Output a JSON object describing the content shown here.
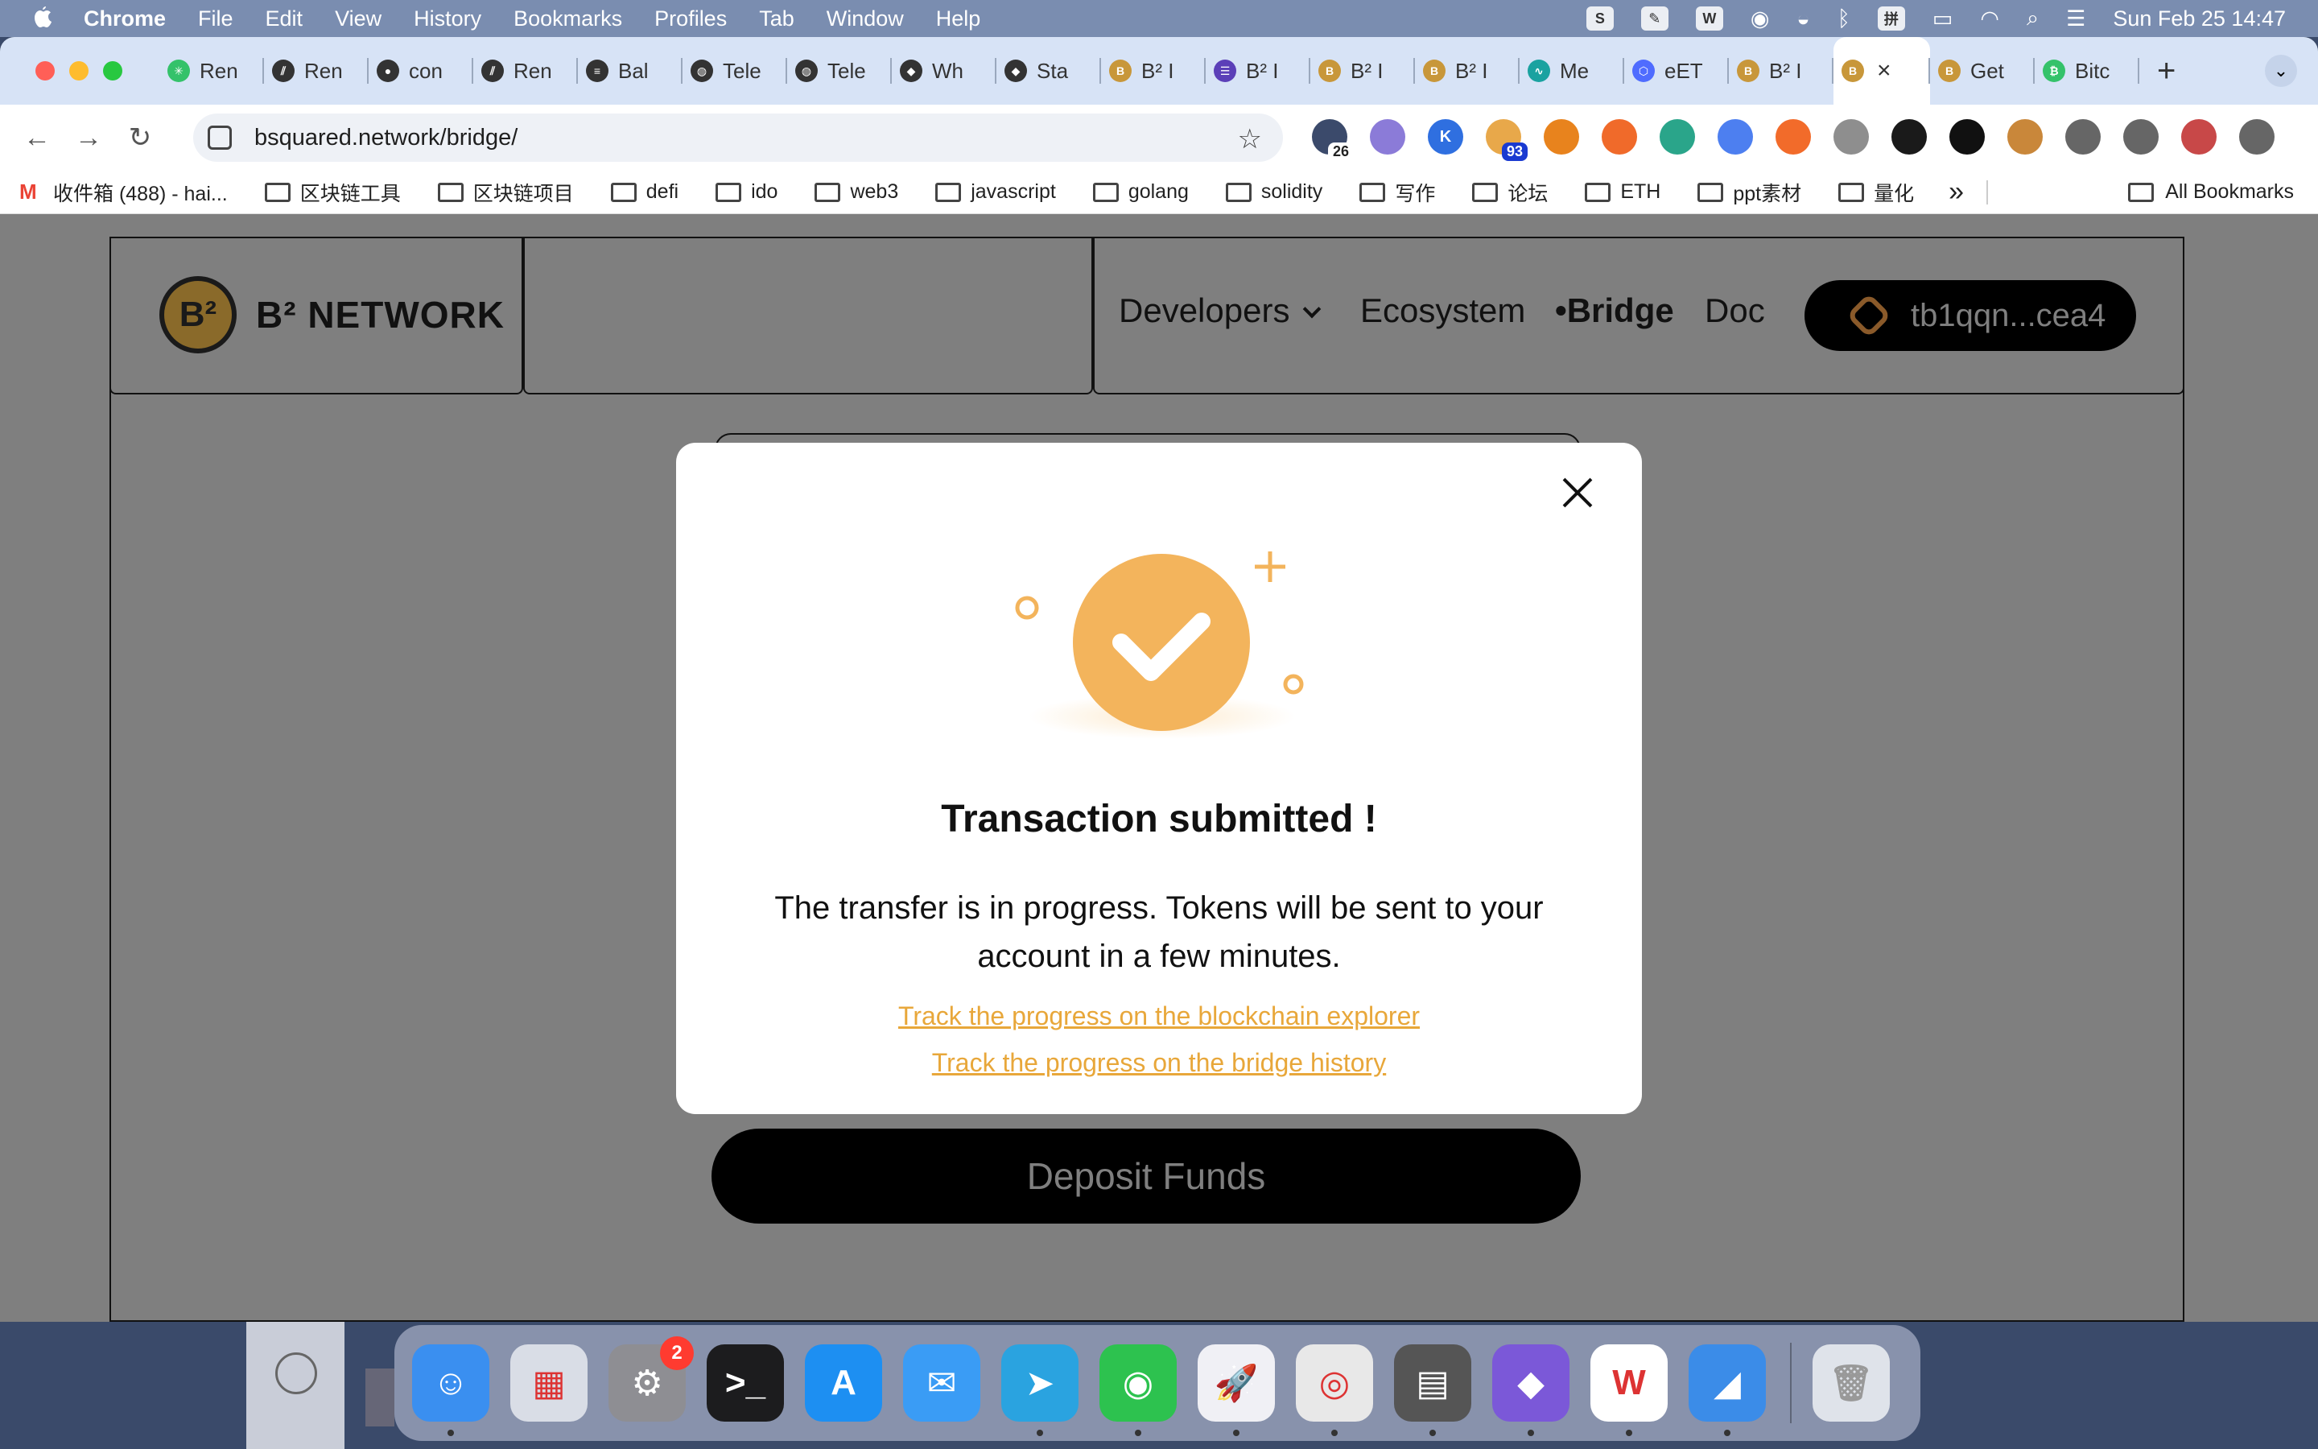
{
  "menubar": {
    "app": "Chrome",
    "items": [
      "File",
      "Edit",
      "View",
      "History",
      "Bookmarks",
      "Profiles",
      "Tab",
      "Window",
      "Help"
    ],
    "clock": "Sun Feb 25  14:47"
  },
  "tabs": [
    {
      "title": "Ren",
      "icon": "sparkle-icon",
      "color": "green"
    },
    {
      "title": "Ren",
      "icon": "stripes-icon",
      "color": "dark"
    },
    {
      "title": "con",
      "icon": "github-icon",
      "color": "dark"
    },
    {
      "title": "Ren",
      "icon": "stripes-icon",
      "color": "dark"
    },
    {
      "title": "Bal",
      "icon": "stack-icon",
      "color": "dark"
    },
    {
      "title": "Tele",
      "icon": "globe-icon",
      "color": "dark"
    },
    {
      "title": "Tele",
      "icon": "globe-icon",
      "color": "dark"
    },
    {
      "title": "Wh",
      "icon": "diamond-icon",
      "color": "dark"
    },
    {
      "title": "Sta",
      "icon": "diamond-icon",
      "color": "dark"
    },
    {
      "title": "B² I",
      "icon": "b2-coin-icon",
      "color": "gold"
    },
    {
      "title": "B² I",
      "icon": "list-icon",
      "color": "purple"
    },
    {
      "title": "B² I",
      "icon": "b2-coin-icon",
      "color": "gold"
    },
    {
      "title": "B² I",
      "icon": "b2-coin-icon",
      "color": "gold"
    },
    {
      "title": "Me",
      "icon": "wave-icon",
      "color": "teal"
    },
    {
      "title": "eET",
      "icon": "hex-icon",
      "color": "blue"
    },
    {
      "title": "B² I",
      "icon": "b2-coin-icon",
      "color": "gold"
    },
    {
      "title": "",
      "icon": "b2-coin-icon",
      "color": "gold",
      "active": true
    },
    {
      "title": "Get",
      "icon": "b2-coin-icon",
      "color": "gold"
    },
    {
      "title": "Bitc",
      "icon": "bitcoin-icon",
      "color": "green"
    }
  ],
  "toolbar": {
    "url": "bsquared.network/bridge/",
    "extensions": [
      {
        "icon": "ext-1-icon",
        "color": "#3b4a6b",
        "badge": "26",
        "badge_style": "plain"
      },
      {
        "icon": "ext-2-icon",
        "color": "#8b7bd8"
      },
      {
        "icon": "ext-k-icon",
        "color": "#2f6fe0",
        "glyph": "K"
      },
      {
        "icon": "ext-mail-icon",
        "color": "#e8a84a",
        "badge": "93"
      },
      {
        "icon": "metamask-icon",
        "color": "#e8831d"
      },
      {
        "icon": "ext-phantom-icon",
        "color": "#f06a2a"
      },
      {
        "icon": "ext-chat-icon",
        "color": "#2aa58a"
      },
      {
        "icon": "translate-icon",
        "color": "#4d7ff0"
      },
      {
        "icon": "ext-t-icon",
        "color": "#f26b2a"
      },
      {
        "icon": "ext-x-icon",
        "color": "#8e8e8e"
      },
      {
        "icon": "shield-icon",
        "color": "#1a1a1a"
      },
      {
        "icon": "ext-dice-icon",
        "color": "#111"
      },
      {
        "icon": "ext-chain-icon",
        "color": "#c9873a"
      },
      {
        "icon": "puzzle-icon",
        "color": "#666"
      },
      {
        "icon": "sidepanel-icon",
        "color": "#666"
      },
      {
        "icon": "profile-avatar-icon",
        "color": "#c84848"
      },
      {
        "icon": "kebab-menu-icon",
        "color": "#666"
      }
    ]
  },
  "bookmarks": {
    "items": [
      "收件箱 (488) - hai...",
      "区块链工具",
      "区块链项目",
      "defi",
      "ido",
      "web3",
      "javascript",
      "golang",
      "solidity",
      "写作",
      "论坛",
      "ETH",
      "ppt素材",
      "量化"
    ],
    "all": "All Bookmarks"
  },
  "site": {
    "logo": "B² NETWORK",
    "logo_mark": "B²",
    "nav": {
      "developers": "Developers",
      "ecosystem": "Ecosystem",
      "bridge": "•Bridge",
      "doc": "Doc"
    },
    "wallet": "tb1qqn...cea4",
    "deposit": "Deposit Funds"
  },
  "modal": {
    "title": "Transaction submitted !",
    "body": "The transfer is in progress. Tokens will be sent to your account in a few minutes.",
    "link_explorer": "Track the progress on the blockchain explorer",
    "link_history": "Track the progress on the bridge history",
    "accent": "#f3b45c",
    "link_color": "#e8a73a"
  },
  "dock": {
    "apps": [
      {
        "name": "finder-icon",
        "color": "#3a8ff0",
        "glyph": "☺",
        "running": true
      },
      {
        "name": "launchpad-icon",
        "color": "#d9dde6",
        "glyph": "▦"
      },
      {
        "name": "system-settings-icon",
        "color": "#8e8e93",
        "glyph": "⚙",
        "badge": "2"
      },
      {
        "name": "terminal-icon",
        "color": "#1c1c1e",
        "glyph": ">_"
      },
      {
        "name": "app-store-icon",
        "color": "#1d8ff2",
        "glyph": "A"
      },
      {
        "name": "mail-icon",
        "color": "#3a9cf5",
        "glyph": "✉"
      },
      {
        "name": "telegram-icon",
        "color": "#2aa3e0",
        "glyph": "➤",
        "running": true
      },
      {
        "name": "wechat-icon",
        "color": "#2dc24f",
        "glyph": "◉",
        "running": true
      },
      {
        "name": "rocket-icon",
        "color": "#f0f0f5",
        "glyph": "🚀",
        "running": true
      },
      {
        "name": "chrome-icon",
        "color": "#e8e8e8",
        "glyph": "◎",
        "running": true
      },
      {
        "name": "calculator-icon",
        "color": "#555",
        "glyph": "▤",
        "running": true
      },
      {
        "name": "obsidian-icon",
        "color": "#7b58d8",
        "glyph": "◆",
        "running": true
      },
      {
        "name": "wps-icon",
        "color": "#fff",
        "glyph": "W",
        "running": true
      },
      {
        "name": "preview-icon",
        "color": "#3b8ce8",
        "glyph": "◢",
        "running": true
      }
    ]
  }
}
